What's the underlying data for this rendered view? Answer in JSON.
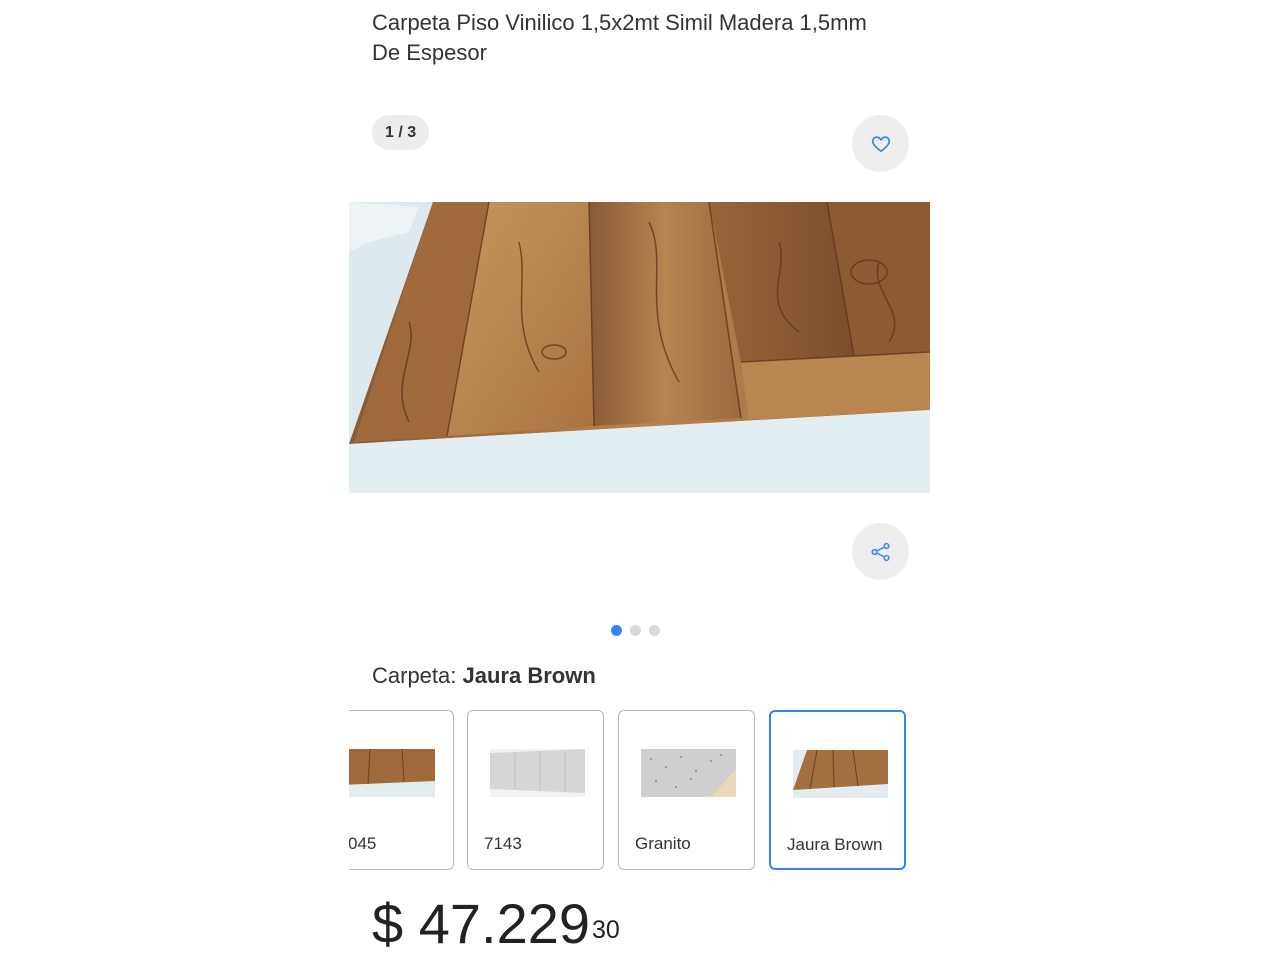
{
  "product": {
    "title": "Carpeta Piso Vinilico 1,5x2mt Simil Madera 1,5mm De Espesor"
  },
  "gallery": {
    "counter": "1 / 3",
    "favorite_icon": "heart-icon",
    "share_icon": "share-icon",
    "pagination": {
      "total": 3,
      "active": 1
    }
  },
  "variant": {
    "label": "Carpeta:",
    "selected": "Jaura Brown",
    "options": [
      {
        "label": "045",
        "image": "brown-wood-floor"
      },
      {
        "label": "7143",
        "image": "grey-wood-floor"
      },
      {
        "label": "Granito",
        "image": "granite-floor"
      },
      {
        "label": "Jaura Brown",
        "image": "jaura-brown-floor"
      }
    ]
  },
  "price": {
    "currency": "$",
    "amount": "47.229",
    "cents": "30"
  },
  "colors": {
    "accent": "#3483fa",
    "text": "#333333"
  }
}
